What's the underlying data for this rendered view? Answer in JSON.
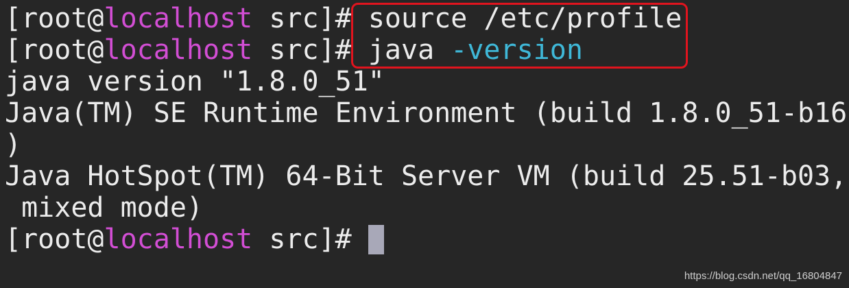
{
  "prompt": {
    "open": "[root@",
    "host": "localhost",
    "close": " src]# "
  },
  "lines": {
    "cmd1": "source /etc/profile",
    "cmd2_name": "java",
    "cmd2_flag": "-version",
    "out1": "java version \"1.8.0_51\"",
    "out2": "Java(TM) SE Runtime Environment (build 1.8.0_51-b16",
    "out3": ")",
    "out4": "Java HotSpot(TM) 64-Bit Server VM (build 25.51-b03,",
    "out5": " mixed mode)"
  },
  "watermark": "https://blog.csdn.net/qq_16804847",
  "colors": {
    "background": "#262626",
    "text": "#ececec",
    "hostname": "#d24ed4",
    "flag": "#3fb8d8",
    "highlight_border": "#e0141e",
    "cursor": "#a8a8b8"
  }
}
